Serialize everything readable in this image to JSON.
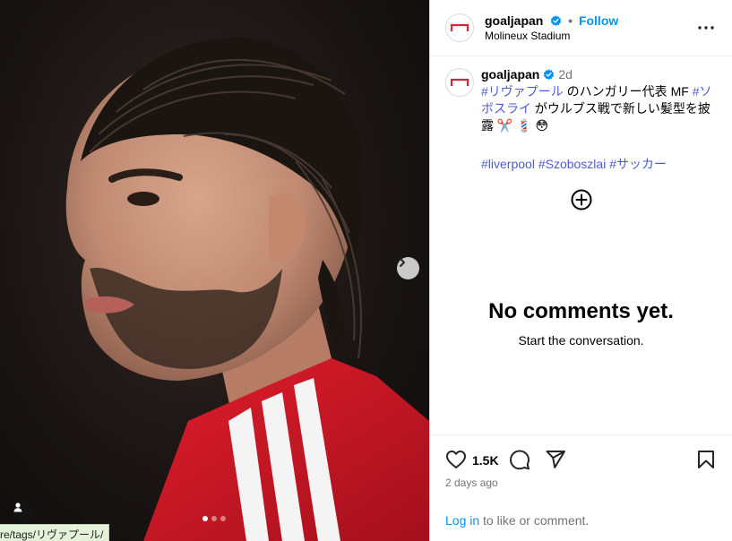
{
  "post_header": {
    "username": "goaljapan",
    "separator": "•",
    "follow_label": "Follow",
    "location": "Molineux Stadium"
  },
  "caption": {
    "username": "goaljapan",
    "time": "2d",
    "tag_liverpool_jp": "#リヴァプール",
    "text_1": " のハンガリー代表 MF ",
    "tag_szoboszlai_jp": "#ソボスライ",
    "text_2": " がウルブス戦で新しい髪型を披露 ✂️ 💈 😳",
    "tags": [
      "#liverpool",
      "#Szoboszlai",
      "#サッカー"
    ]
  },
  "comments": {
    "empty_title": "No comments yet.",
    "empty_subtitle": "Start the conversation."
  },
  "actions": {
    "likes": "1.5K",
    "timestamp": "2 days ago",
    "login_link": "Log in",
    "login_suffix": " to like or comment."
  },
  "carousel": {
    "total": 3,
    "active_index": 0
  },
  "status_bar": {
    "url": "re/tags/リヴァプール/"
  },
  "colors": {
    "follow_blue": "#0095f6",
    "hashtag_blue": "#4e5bd6",
    "verified_blue": "#0095f6",
    "brand_red": "#d9233b"
  },
  "icons": [
    "goal-logo-icon",
    "verified-icon",
    "more-icon",
    "plus-circle-icon",
    "heart-icon",
    "comment-icon",
    "share-icon",
    "bookmark-icon",
    "chevron-right-icon",
    "user-tag-icon"
  ]
}
